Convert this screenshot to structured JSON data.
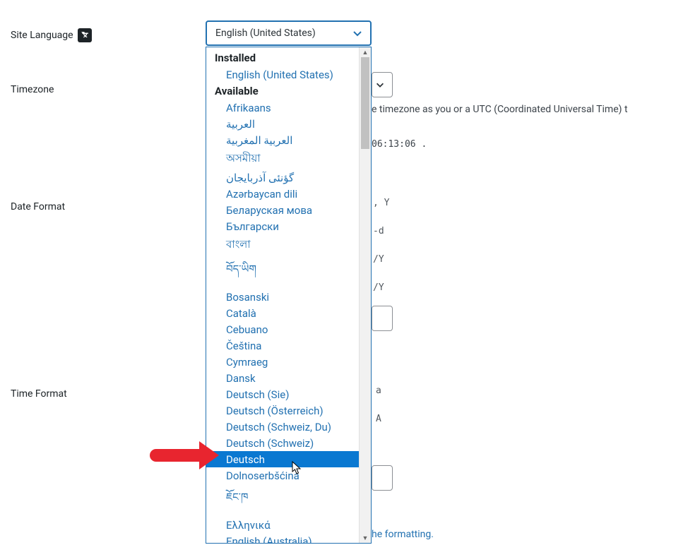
{
  "labels": {
    "site_language": "Site Language",
    "timezone": "Timezone",
    "date_format": "Date Format",
    "time_format": "Time Format"
  },
  "site_language_select": {
    "selected": "English (United States)"
  },
  "language_dropdown": {
    "groups": [
      {
        "label": "Installed",
        "items": [
          "English (United States)"
        ]
      },
      {
        "label": "Available",
        "items": [
          "Afrikaans",
          "العربية",
          "العربية المغربية",
          "অসমীয়া",
          "گؤنئی آذربایجان",
          "Azərbaycan dili",
          "Беларуская мова",
          "Български",
          "বাংলা",
          "བོད་ཡིག",
          "Bosanski",
          "Català",
          "Cebuano",
          "Čeština",
          "Cymraeg",
          "Dansk",
          "Deutsch (Sie)",
          "Deutsch (Österreich)",
          "Deutsch (Schweiz, Du)",
          "Deutsch (Schweiz)",
          "Deutsch",
          "Dolnoserbšćina",
          "ཇོང་ཁ",
          "Ελληνικά",
          "English (Australia)"
        ],
        "highlighted_index": 20
      }
    ]
  },
  "timezone": {
    "helper_text_fragment": "e timezone as you or a UTC (Coordinated Universal Time) t",
    "time_fragment": "06:13:06 ."
  },
  "date_format": {
    "tags": [
      ", Y",
      "-d",
      "/Y",
      "/Y"
    ]
  },
  "time_format": {
    "tags": [
      "a",
      "A"
    ]
  },
  "footer_link_fragment": "he formatting."
}
